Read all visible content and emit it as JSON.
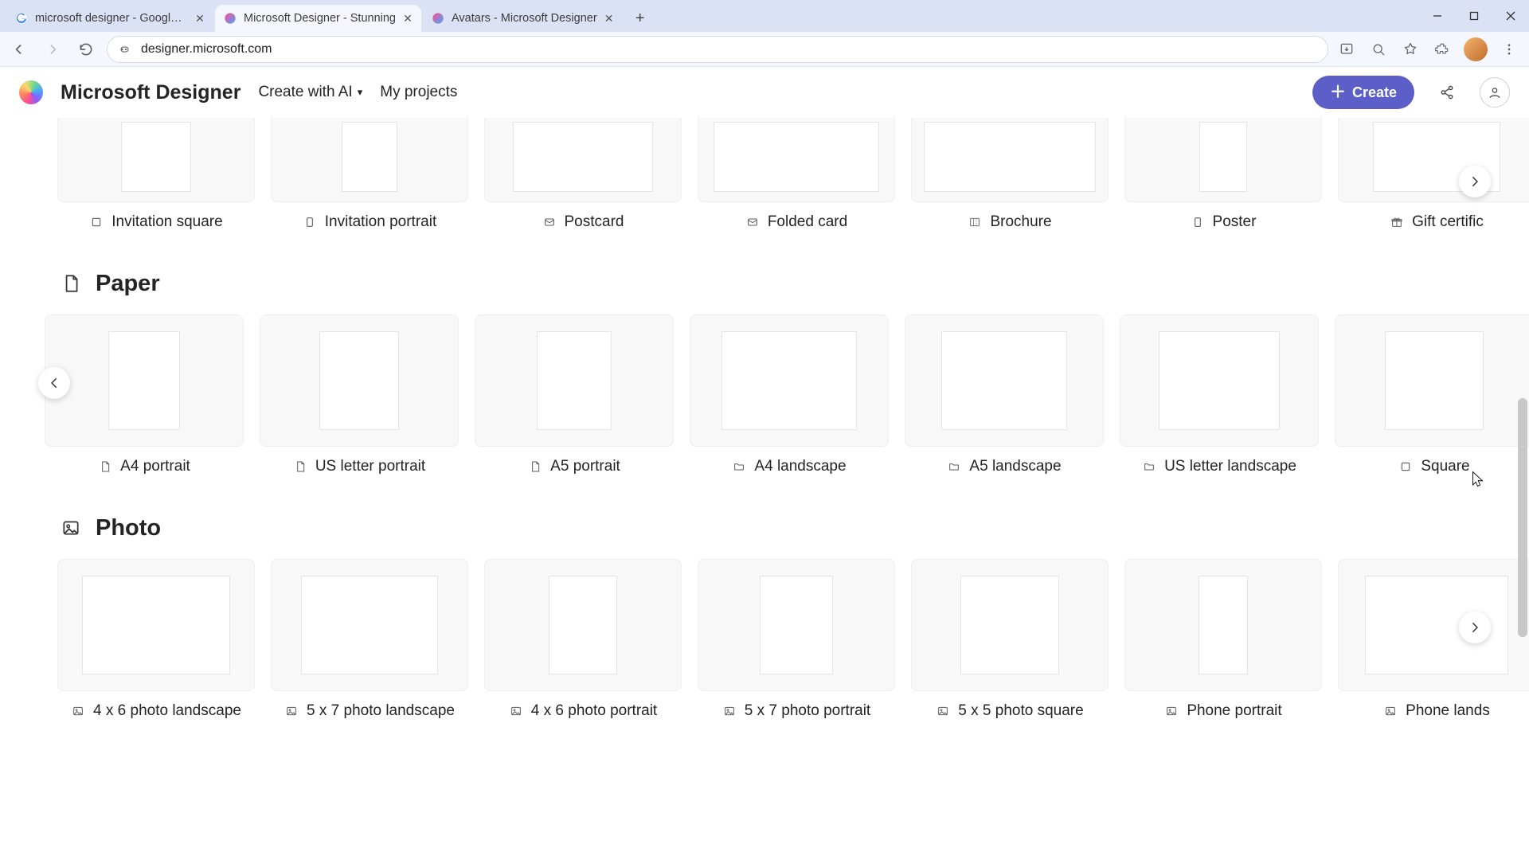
{
  "browser": {
    "tabs": [
      {
        "title": "microsoft designer - Google Se",
        "active": false,
        "favicon": "google"
      },
      {
        "title": "Microsoft Designer - Stunning",
        "active": true,
        "favicon": "designer"
      },
      {
        "title": "Avatars - Microsoft Designer",
        "active": false,
        "favicon": "designer"
      }
    ],
    "url": "designer.microsoft.com"
  },
  "header": {
    "brand": "Microsoft Designer",
    "nav_create_ai": "Create with AI",
    "nav_projects": "My projects",
    "create_button": "Create"
  },
  "sections": {
    "top_row": {
      "items": [
        {
          "label": "Invitation square",
          "icon": "square",
          "inner_w": 88,
          "inner_h": 88
        },
        {
          "label": "Invitation portrait",
          "icon": "portrait",
          "inner_w": 70,
          "inner_h": 88
        },
        {
          "label": "Postcard",
          "icon": "mail",
          "inner_w": 176,
          "inner_h": 88
        },
        {
          "label": "Folded card",
          "icon": "mail",
          "inner_w": 208,
          "inner_h": 88
        },
        {
          "label": "Brochure",
          "icon": "brochure",
          "inner_w": 216,
          "inner_h": 88
        },
        {
          "label": "Poster",
          "icon": "portrait",
          "inner_w": 60,
          "inner_h": 88
        },
        {
          "label": "Gift certific",
          "icon": "gift",
          "inner_w": 160,
          "inner_h": 88
        }
      ]
    },
    "paper": {
      "title": "Paper",
      "items": [
        {
          "label": "A4 portrait",
          "icon": "page",
          "inner_w": 90,
          "inner_h": 124
        },
        {
          "label": "US letter portrait",
          "icon": "page",
          "inner_w": 100,
          "inner_h": 124
        },
        {
          "label": "A5 portrait",
          "icon": "page",
          "inner_w": 94,
          "inner_h": 124
        },
        {
          "label": "A4 landscape",
          "icon": "folder",
          "inner_w": 170,
          "inner_h": 124
        },
        {
          "label": "A5 landscape",
          "icon": "folder",
          "inner_w": 158,
          "inner_h": 124
        },
        {
          "label": "US letter landscape",
          "icon": "folder",
          "inner_w": 152,
          "inner_h": 124
        },
        {
          "label": "Square",
          "icon": "square",
          "inner_w": 124,
          "inner_h": 124
        }
      ]
    },
    "photo": {
      "title": "Photo",
      "items": [
        {
          "label": "4 x 6 photo landscape",
          "icon": "image",
          "inner_w": 186,
          "inner_h": 124
        },
        {
          "label": "5 x 7 photo landscape",
          "icon": "image",
          "inner_w": 172,
          "inner_h": 124
        },
        {
          "label": "4 x 6 photo portrait",
          "icon": "image",
          "inner_w": 86,
          "inner_h": 124
        },
        {
          "label": "5 x 7 photo portrait",
          "icon": "image",
          "inner_w": 92,
          "inner_h": 124
        },
        {
          "label": "5 x 5 photo square",
          "icon": "image",
          "inner_w": 124,
          "inner_h": 124
        },
        {
          "label": "Phone portrait",
          "icon": "image",
          "inner_w": 62,
          "inner_h": 124
        },
        {
          "label": "Phone lands",
          "icon": "image",
          "inner_w": 180,
          "inner_h": 124
        }
      ]
    }
  },
  "colors": {
    "accent": "#5b5fc7"
  }
}
